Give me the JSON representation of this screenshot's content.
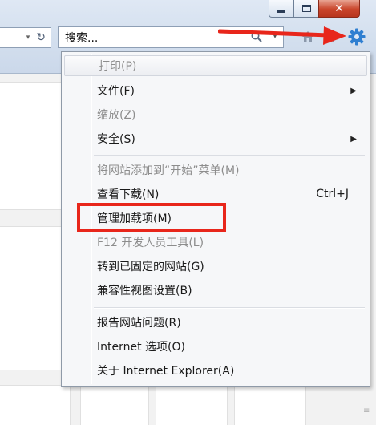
{
  "window": {
    "minimize_icon": "minimize-icon",
    "maximize_icon": "maximize-icon",
    "close_icon": "close-icon",
    "close_glyph": "✕"
  },
  "address_bar": {
    "dropdown_glyph": "▾",
    "refresh_glyph": "↻"
  },
  "search": {
    "value": "搜索...",
    "dropdown_glyph": "▾"
  },
  "toolbar": {
    "icons": [
      "home-icon",
      "favorites-icon",
      "tools-gear-icon"
    ]
  },
  "menu": {
    "items": [
      {
        "label": "打印(P)",
        "disabled": true,
        "submenu": false
      },
      {
        "label": "文件(F)",
        "disabled": false,
        "submenu": true
      },
      {
        "label": "缩放(Z)",
        "disabled": true,
        "submenu": false
      },
      {
        "label": "安全(S)",
        "disabled": false,
        "submenu": true
      },
      {
        "label": "将网站添加到“开始”菜单(M)",
        "disabled": true,
        "submenu": false
      },
      {
        "label": "查看下载(N)",
        "disabled": false,
        "shortcut": "Ctrl+J"
      },
      {
        "label": "管理加载项(M)",
        "disabled": false,
        "submenu": false
      },
      {
        "label": "F12 开发人员工具(L)",
        "disabled": true,
        "submenu": false
      },
      {
        "label": "转到已固定的网站(G)",
        "disabled": false,
        "submenu": false
      },
      {
        "label": "兼容性视图设置(B)",
        "disabled": false,
        "submenu": false
      },
      {
        "label": "报告网站问题(R)",
        "disabled": false,
        "submenu": false
      },
      {
        "label": "Internet 选项(O)",
        "disabled": false,
        "submenu": false
      },
      {
        "label": "关于 Internet Explorer(A)",
        "disabled": false,
        "submenu": false
      }
    ],
    "submenu_glyph": "▶"
  },
  "annotation_colors": {
    "arrow": "#e8261b",
    "highlight_box": "#e8261b"
  }
}
